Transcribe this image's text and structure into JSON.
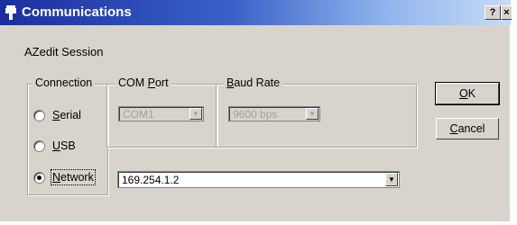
{
  "window": {
    "title": "Communications",
    "help_label": "?",
    "close_label": "×"
  },
  "session": {
    "label": "AZedit Session"
  },
  "connection": {
    "legend": "Connection",
    "options": [
      {
        "prefix": "",
        "mnemonic": "S",
        "rest": "erial",
        "selected": false
      },
      {
        "prefix": "",
        "mnemonic": "U",
        "rest": "SB",
        "selected": false
      },
      {
        "prefix": "",
        "mnemonic": "N",
        "rest": "etwork",
        "selected": true
      }
    ]
  },
  "com_port": {
    "legend_prefix": "COM ",
    "legend_mnemonic": "P",
    "legend_rest": "ort",
    "value": "COM1",
    "enabled": false
  },
  "baud_rate": {
    "legend_mnemonic": "B",
    "legend_rest": "aud Rate",
    "value": "9600 bps",
    "enabled": false
  },
  "network": {
    "address": "169.254.1.2"
  },
  "buttons": {
    "ok": {
      "mnemonic": "O",
      "rest": "K"
    },
    "cancel": {
      "mnemonic": "C",
      "rest": "ancel"
    }
  },
  "icons": {
    "dropdown": "▼"
  }
}
